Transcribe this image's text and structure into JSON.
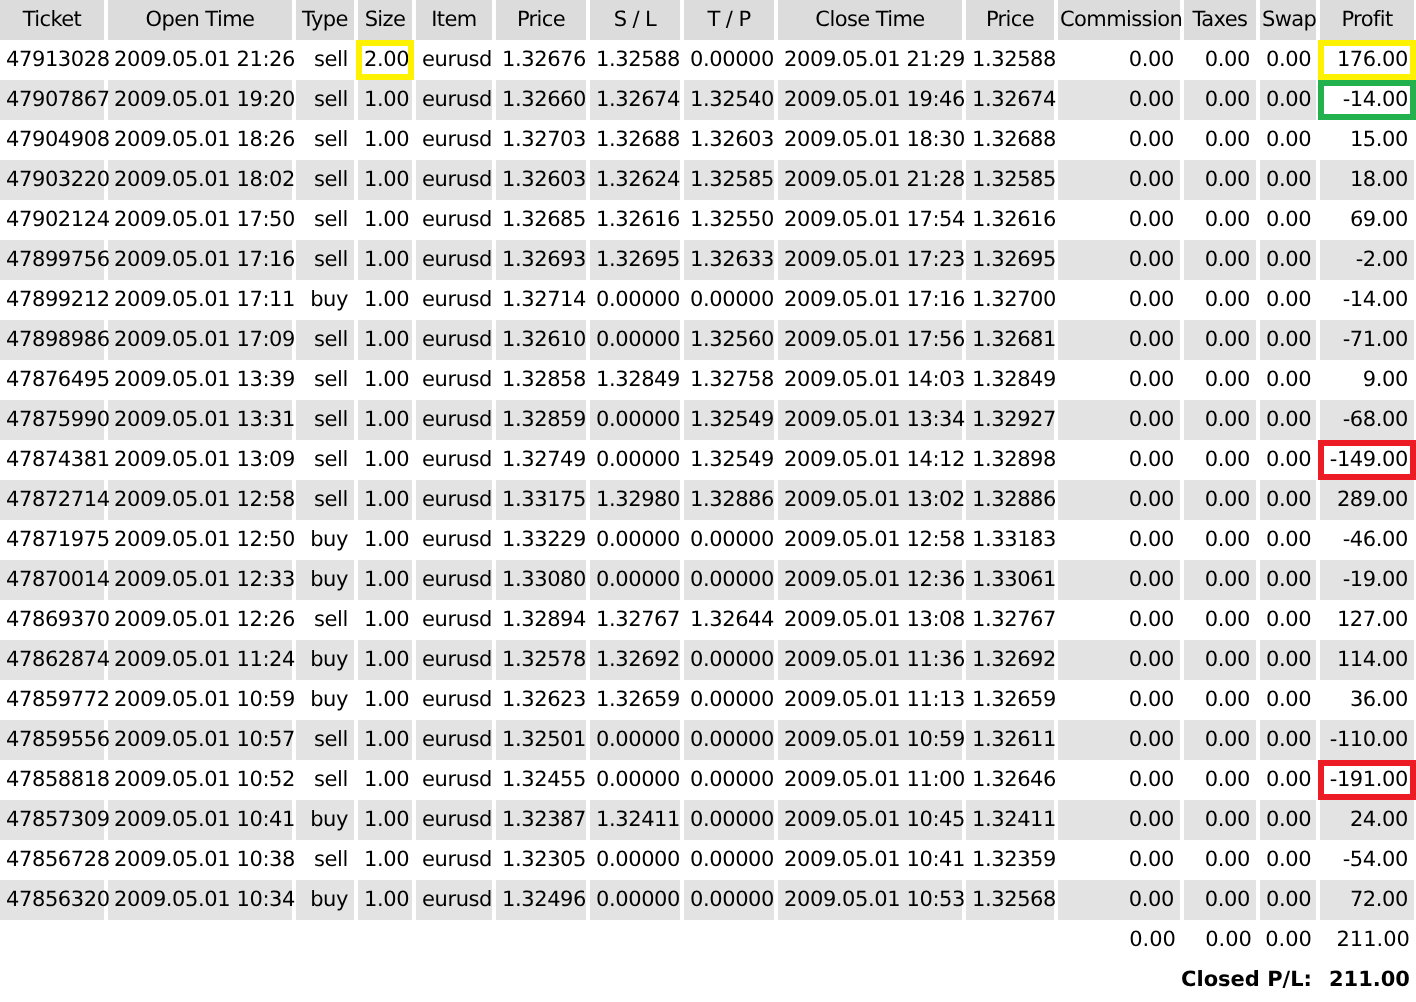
{
  "table": {
    "columns": [
      "Ticket",
      "Open Time",
      "Type",
      "Size",
      "Item",
      "Price",
      "S / L",
      "T / P",
      "Close Time",
      "Price",
      "Commission",
      "Taxes",
      "Swap",
      "Profit"
    ],
    "rows": [
      {
        "cells": [
          "47913028",
          "2009.05.01 21:26",
          "sell",
          {
            "text": "2.00",
            "color": "#fff200"
          },
          "eurusd",
          "1.32676",
          "1.32588",
          "0.00000",
          "2009.05.01 21:29",
          "1.32588",
          "0.00",
          "0.00",
          "0.00",
          {
            "text": "176.00",
            "color": "#fff200"
          }
        ]
      },
      {
        "cells": [
          "47907867",
          "2009.05.01 19:20",
          "sell",
          "1.00",
          "eurusd",
          "1.32660",
          "1.32674",
          "1.32540",
          "2009.05.01 19:46",
          "1.32674",
          "0.00",
          "0.00",
          "0.00",
          {
            "text": "-14.00",
            "color": "#22b14c"
          }
        ]
      },
      {
        "cells": [
          "47904908",
          "2009.05.01 18:26",
          "sell",
          "1.00",
          "eurusd",
          "1.32703",
          "1.32688",
          "1.32603",
          "2009.05.01 18:30",
          "1.32688",
          "0.00",
          "0.00",
          "0.00",
          "15.00"
        ]
      },
      {
        "cells": [
          "47903220",
          "2009.05.01 18:02",
          "sell",
          "1.00",
          "eurusd",
          "1.32603",
          "1.32624",
          "1.32585",
          "2009.05.01 21:28",
          "1.32585",
          "0.00",
          "0.00",
          "0.00",
          "18.00"
        ]
      },
      {
        "cells": [
          "47902124",
          "2009.05.01 17:50",
          "sell",
          "1.00",
          "eurusd",
          "1.32685",
          "1.32616",
          "1.32550",
          "2009.05.01 17:54",
          "1.32616",
          "0.00",
          "0.00",
          "0.00",
          "69.00"
        ]
      },
      {
        "cells": [
          "47899756",
          "2009.05.01 17:16",
          "sell",
          "1.00",
          "eurusd",
          "1.32693",
          "1.32695",
          "1.32633",
          "2009.05.01 17:23",
          "1.32695",
          "0.00",
          "0.00",
          "0.00",
          "-2.00"
        ]
      },
      {
        "cells": [
          "47899212",
          "2009.05.01 17:11",
          "buy",
          "1.00",
          "eurusd",
          "1.32714",
          "0.00000",
          "0.00000",
          "2009.05.01 17:16",
          "1.32700",
          "0.00",
          "0.00",
          "0.00",
          "-14.00"
        ]
      },
      {
        "cells": [
          "47898986",
          "2009.05.01 17:09",
          "sell",
          "1.00",
          "eurusd",
          "1.32610",
          "0.00000",
          "1.32560",
          "2009.05.01 17:56",
          "1.32681",
          "0.00",
          "0.00",
          "0.00",
          "-71.00"
        ]
      },
      {
        "cells": [
          "47876495",
          "2009.05.01 13:39",
          "sell",
          "1.00",
          "eurusd",
          "1.32858",
          "1.32849",
          "1.32758",
          "2009.05.01 14:03",
          "1.32849",
          "0.00",
          "0.00",
          "0.00",
          "9.00"
        ]
      },
      {
        "cells": [
          "47875990",
          "2009.05.01 13:31",
          "sell",
          "1.00",
          "eurusd",
          "1.32859",
          "0.00000",
          "1.32549",
          "2009.05.01 13:34",
          "1.32927",
          "0.00",
          "0.00",
          "0.00",
          "-68.00"
        ]
      },
      {
        "cells": [
          "47874381",
          "2009.05.01 13:09",
          "sell",
          "1.00",
          "eurusd",
          "1.32749",
          "0.00000",
          "1.32549",
          "2009.05.01 14:12",
          "1.32898",
          "0.00",
          "0.00",
          "0.00",
          {
            "text": "-149.00",
            "color": "#ed1c24"
          }
        ]
      },
      {
        "cells": [
          "47872714",
          "2009.05.01 12:58",
          "sell",
          "1.00",
          "eurusd",
          "1.33175",
          "1.32980",
          "1.32886",
          "2009.05.01 13:02",
          "1.32886",
          "0.00",
          "0.00",
          "0.00",
          "289.00"
        ]
      },
      {
        "cells": [
          "47871975",
          "2009.05.01 12:50",
          "buy",
          "1.00",
          "eurusd",
          "1.33229",
          "0.00000",
          "0.00000",
          "2009.05.01 12:58",
          "1.33183",
          "0.00",
          "0.00",
          "0.00",
          "-46.00"
        ]
      },
      {
        "cells": [
          "47870014",
          "2009.05.01 12:33",
          "buy",
          "1.00",
          "eurusd",
          "1.33080",
          "0.00000",
          "0.00000",
          "2009.05.01 12:36",
          "1.33061",
          "0.00",
          "0.00",
          "0.00",
          "-19.00"
        ]
      },
      {
        "cells": [
          "47869370",
          "2009.05.01 12:26",
          "sell",
          "1.00",
          "eurusd",
          "1.32894",
          "1.32767",
          "1.32644",
          "2009.05.01 13:08",
          "1.32767",
          "0.00",
          "0.00",
          "0.00",
          "127.00"
        ]
      },
      {
        "cells": [
          "47862874",
          "2009.05.01 11:24",
          "buy",
          "1.00",
          "eurusd",
          "1.32578",
          "1.32692",
          "0.00000",
          "2009.05.01 11:36",
          "1.32692",
          "0.00",
          "0.00",
          "0.00",
          "114.00"
        ]
      },
      {
        "cells": [
          "47859772",
          "2009.05.01 10:59",
          "buy",
          "1.00",
          "eurusd",
          "1.32623",
          "1.32659",
          "0.00000",
          "2009.05.01 11:13",
          "1.32659",
          "0.00",
          "0.00",
          "0.00",
          "36.00"
        ]
      },
      {
        "cells": [
          "47859556",
          "2009.05.01 10:57",
          "sell",
          "1.00",
          "eurusd",
          "1.32501",
          "0.00000",
          "0.00000",
          "2009.05.01 10:59",
          "1.32611",
          "0.00",
          "0.00",
          "0.00",
          "-110.00"
        ]
      },
      {
        "cells": [
          "47858818",
          "2009.05.01 10:52",
          "sell",
          "1.00",
          "eurusd",
          "1.32455",
          "0.00000",
          "0.00000",
          "2009.05.01 11:00",
          "1.32646",
          "0.00",
          "0.00",
          "0.00",
          {
            "text": "-191.00",
            "color": "#ed1c24"
          }
        ]
      },
      {
        "cells": [
          "47857309",
          "2009.05.01 10:41",
          "buy",
          "1.00",
          "eurusd",
          "1.32387",
          "1.32411",
          "0.00000",
          "2009.05.01 10:45",
          "1.32411",
          "0.00",
          "0.00",
          "0.00",
          "24.00"
        ]
      },
      {
        "cells": [
          "47856728",
          "2009.05.01 10:38",
          "sell",
          "1.00",
          "eurusd",
          "1.32305",
          "0.00000",
          "0.00000",
          "2009.05.01 10:41",
          "1.32359",
          "0.00",
          "0.00",
          "0.00",
          "-54.00"
        ]
      },
      {
        "cells": [
          "47856320",
          "2009.05.01 10:34",
          "buy",
          "1.00",
          "eurusd",
          "1.32496",
          "0.00000",
          "0.00000",
          "2009.05.01 10:53",
          "1.32568",
          "0.00",
          "0.00",
          "0.00",
          "72.00"
        ]
      }
    ],
    "totals": [
      "0.00",
      "0.00",
      "0.00",
      "211.00"
    ],
    "closed_pl": {
      "label": "Closed P/L:",
      "value": "211.00"
    }
  }
}
